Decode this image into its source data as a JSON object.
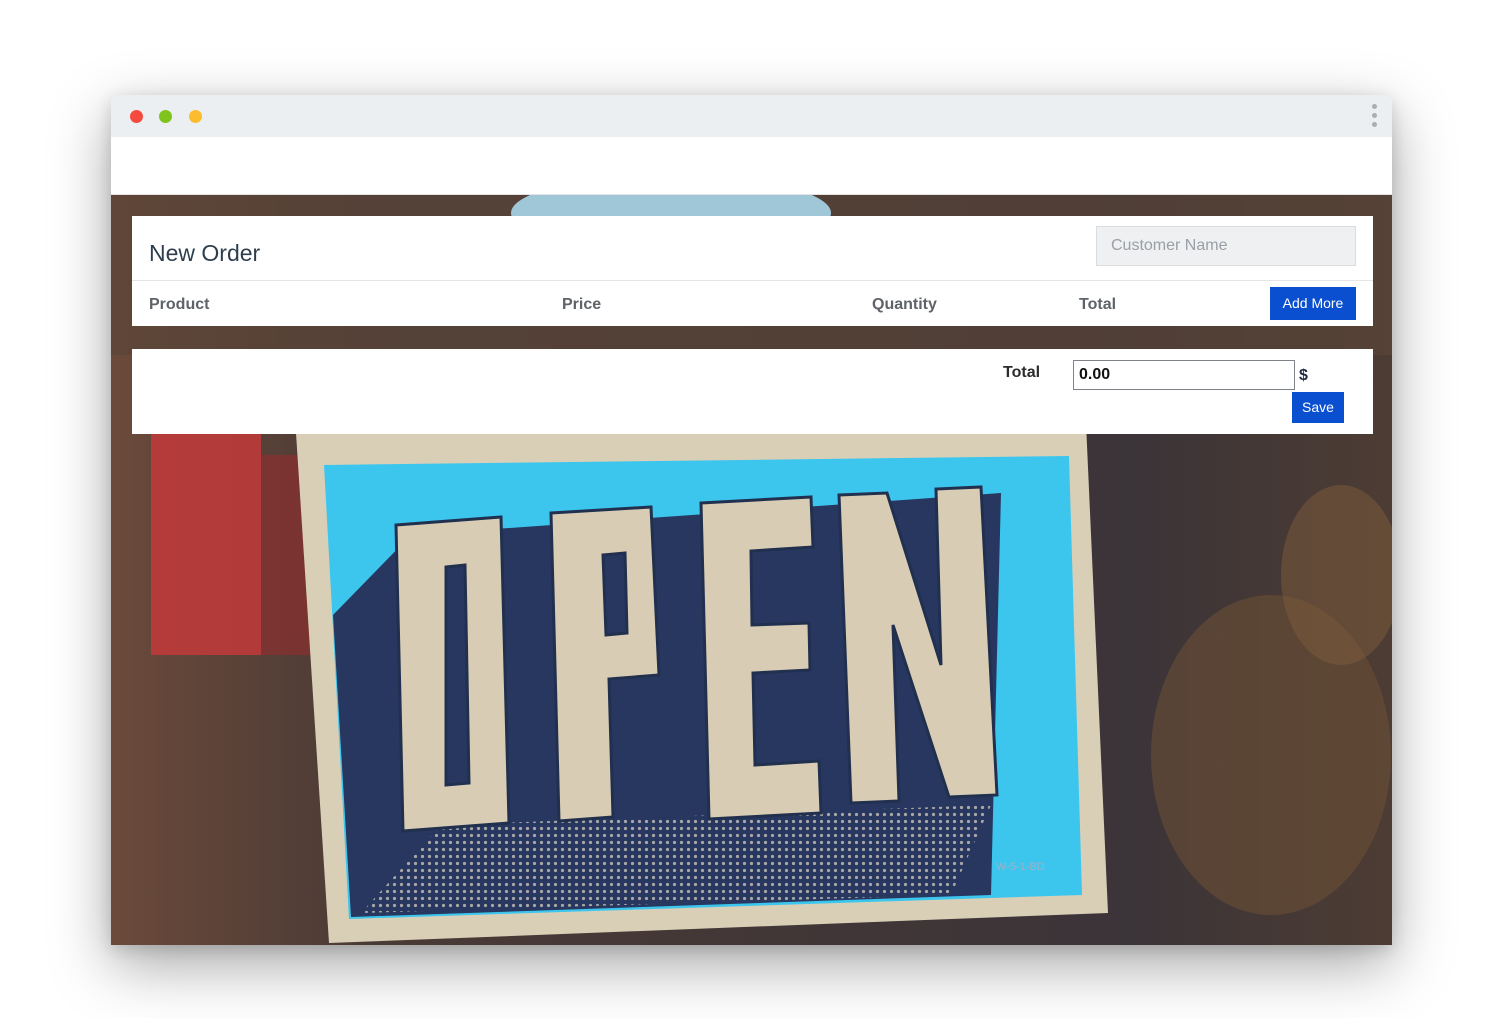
{
  "window": {
    "controls": [
      "close-dot",
      "maximize-dot",
      "minimize-dot"
    ],
    "menu_icon": "kebab-menu-icon"
  },
  "order": {
    "title": "New Order",
    "customer_placeholder": "Customer Name",
    "customer_value": "",
    "columns": [
      "Product",
      "Price",
      "Quantity",
      "Total"
    ],
    "add_more_label": "Add More"
  },
  "summary": {
    "total_label": "Total",
    "total_value": "0.00",
    "currency": "$",
    "save_label": "Save"
  },
  "background": {
    "sign_text": "OPEN",
    "colors": {
      "sign_blue": "#3cc6ee",
      "sign_navy": "#27375f",
      "letters": "#d8cdb4",
      "button": "#0a4fcf"
    }
  }
}
